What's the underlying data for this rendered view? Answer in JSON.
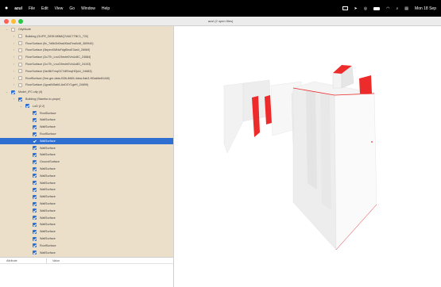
{
  "menubar": {
    "apple_icon": "apple-logo",
    "app_name": "azul",
    "menus": [
      "File",
      "Edit",
      "View",
      "Go",
      "Window",
      "Help"
    ],
    "clock": "Mon 18 Sep"
  },
  "window": {
    "title": "azul (2 open files)"
  },
  "tree": {
    "rows": [
      {
        "indent": 0,
        "twisty": "⌄",
        "checked": false,
        "label": "CityModel"
      },
      {
        "indent": 1,
        "twisty": "›",
        "checked": false,
        "label": "Building (GUFR_DE5HJ8N8Q7A6C7TBC1_720)"
      },
      {
        "indent": 1,
        "twisty": "›",
        "checked": false,
        "label": "FloorSurface (ifc_7d6b2b0ba4f0ad7ea0c6f_369940)"
      },
      {
        "indent": 1,
        "twisty": "›",
        "checked": false,
        "label": "FloorSurface (0tqnmXMNsFdgf5noE3ari4_26069)"
      },
      {
        "indent": 1,
        "twisty": "›",
        "checked": false,
        "label": "FloorSurface (2cJTh_LnoC9ecfe0VxUz8C_24584)"
      },
      {
        "indent": 1,
        "twisty": "›",
        "checked": false,
        "label": "FloorSurface (2cJTh_LnoC9ecfe0VxUz8D_24103)"
      },
      {
        "indent": 1,
        "twisty": "›",
        "checked": false,
        "label": "FloorSurface (0ari5kTmqOC7dfEmqHOjoU_24683)"
      },
      {
        "indent": 1,
        "twisty": "›",
        "checked": false,
        "label": "RoofSurface (0ne-gm-data-f336-8665-4dea-9ab3-f00ab6e81440)"
      },
      {
        "indent": 1,
        "twisty": "›",
        "checked": false,
        "label": "FloorSurface (1gosiNSatM-AnDXY1geH_24699)"
      },
      {
        "indent": 0,
        "twisty": "⌄",
        "checked": true,
        "label": "Model_IFC.city (4)"
      },
      {
        "indent": 1,
        "twisty": "›",
        "checked": true,
        "label": "Building (Stamfor-to-prope)"
      },
      {
        "indent": 2,
        "twisty": "⌄",
        "checked": true,
        "label": "LoD (2.2)"
      },
      {
        "indent": 3,
        "twisty": "",
        "checked": true,
        "label": "RoofSurface"
      },
      {
        "indent": 3,
        "twisty": "",
        "checked": true,
        "label": "WallSurface"
      },
      {
        "indent": 3,
        "twisty": "",
        "checked": true,
        "label": "WallSurface"
      },
      {
        "indent": 3,
        "twisty": "",
        "checked": true,
        "label": "RoofSurface"
      },
      {
        "indent": 3,
        "twisty": "",
        "checked": true,
        "label": "WallSurface",
        "selected": true
      },
      {
        "indent": 3,
        "twisty": "",
        "checked": true,
        "label": "WallSurface"
      },
      {
        "indent": 3,
        "twisty": "",
        "checked": true,
        "label": "WallSurface"
      },
      {
        "indent": 3,
        "twisty": "",
        "checked": true,
        "label": "GroundSurface"
      },
      {
        "indent": 3,
        "twisty": "",
        "checked": true,
        "label": "WallSurface"
      },
      {
        "indent": 3,
        "twisty": "",
        "checked": true,
        "label": "WallSurface"
      },
      {
        "indent": 3,
        "twisty": "",
        "checked": true,
        "label": "WallSurface"
      },
      {
        "indent": 3,
        "twisty": "",
        "checked": true,
        "label": "WallSurface"
      },
      {
        "indent": 3,
        "twisty": "",
        "checked": true,
        "label": "WallSurface"
      },
      {
        "indent": 3,
        "twisty": "",
        "checked": true,
        "label": "WallSurface"
      },
      {
        "indent": 3,
        "twisty": "",
        "checked": true,
        "label": "WallSurface"
      },
      {
        "indent": 3,
        "twisty": "",
        "checked": true,
        "label": "WallSurface"
      },
      {
        "indent": 3,
        "twisty": "",
        "checked": true,
        "label": "WallSurface"
      },
      {
        "indent": 3,
        "twisty": "",
        "checked": true,
        "label": "WallSurface"
      },
      {
        "indent": 3,
        "twisty": "",
        "checked": true,
        "label": "WallSurface"
      },
      {
        "indent": 3,
        "twisty": "",
        "checked": true,
        "label": "RoofSurface"
      },
      {
        "indent": 3,
        "twisty": "",
        "checked": true,
        "label": "WallSurface"
      }
    ]
  },
  "attributes": {
    "col_attribute": "Attribute",
    "col_value": "Value"
  },
  "viewport": {
    "highlight_color": "#ee2b2b",
    "wall_color": "#ffffff"
  }
}
